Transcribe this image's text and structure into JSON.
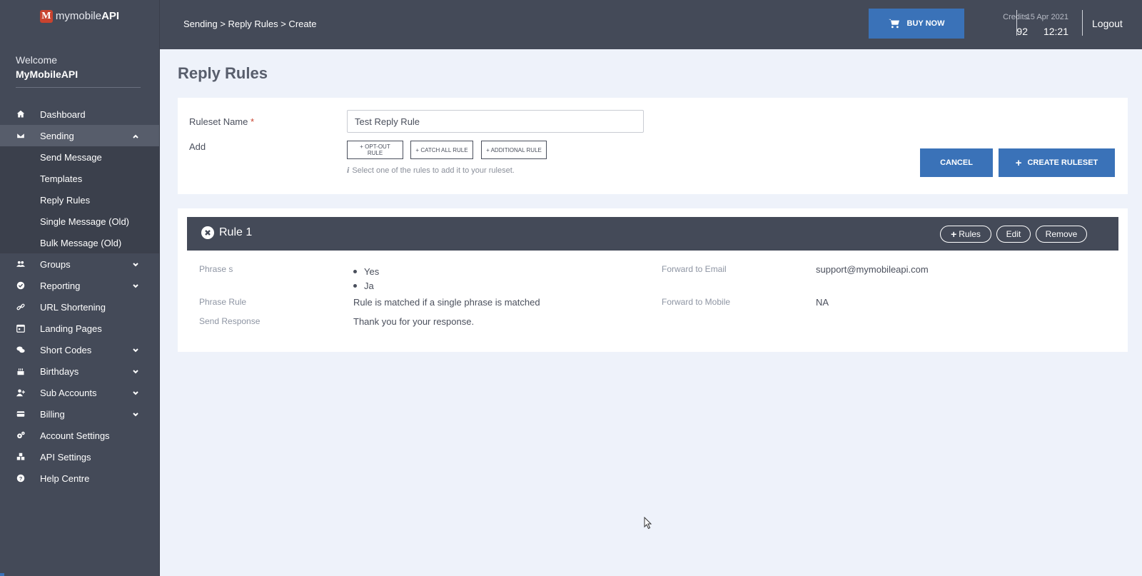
{
  "sidebar": {
    "logo_prefix": "mymobile",
    "logo_suffix": "API",
    "logo_letter": "M",
    "welcome_label": "Welcome",
    "username": "MyMobileAPI",
    "items": [
      {
        "label": "Dashboard",
        "icon": "home-icon"
      },
      {
        "label": "Sending",
        "icon": "envelope-icon",
        "expanded": true
      },
      {
        "label": "Groups",
        "icon": "users-icon"
      },
      {
        "label": "Reporting",
        "icon": "check-circle-icon"
      },
      {
        "label": "URL Shortening",
        "icon": "link-icon"
      },
      {
        "label": "Landing Pages",
        "icon": "calendar-icon"
      },
      {
        "label": "Short Codes",
        "icon": "comments-icon"
      },
      {
        "label": "Birthdays",
        "icon": "cake-icon"
      },
      {
        "label": "Sub Accounts",
        "icon": "user-plus-icon"
      },
      {
        "label": "Billing",
        "icon": "credit-card-icon"
      },
      {
        "label": "Account Settings",
        "icon": "cogs-icon"
      },
      {
        "label": "API Settings",
        "icon": "cubes-icon"
      },
      {
        "label": "Help Centre",
        "icon": "question-circle-icon"
      }
    ],
    "sending_subitems": [
      "Send Message",
      "Templates",
      "Reply Rules",
      "Single Message (Old)",
      "Bulk Message (Old)"
    ]
  },
  "topbar": {
    "breadcrumb": "Sending > Reply Rules > Create",
    "buy_now": "BUY NOW",
    "credits_label": "Credits",
    "credits_value": "92",
    "date": "15 Apr 2021",
    "time": "12:21",
    "logout": "Logout"
  },
  "page": {
    "title": "Reply Rules"
  },
  "form": {
    "ruleset_name_label": "Ruleset Name",
    "required_mark": "*",
    "ruleset_name_value": "Test Reply Rule",
    "add_label": "Add",
    "opt_out_rule": "+ OPT-OUT RULE",
    "catch_all_rule": "+ CATCH ALL RULE",
    "additional_rule": "+ ADDITIONAL RULE",
    "hint": "Select one of the rules to add it to your ruleset.",
    "cancel": "CANCEL",
    "create_ruleset": "CREATE RULESET"
  },
  "rule": {
    "title": "Rule 1",
    "rules_button": "Rules",
    "edit_button": "Edit",
    "remove_button": "Remove",
    "phrases_label": "Phrase s",
    "phrases": [
      "Yes",
      "Ja"
    ],
    "phrase_rule_label": "Phrase Rule",
    "phrase_rule_value": "Rule is matched if a single phrase is matched",
    "send_response_label": "Send Response",
    "send_response_value": "Thank you for your response.",
    "forward_email_label": "Forward to Email",
    "forward_email_value": "support@mymobileapi.com",
    "forward_mobile_label": "Forward to Mobile",
    "forward_mobile_value": "NA"
  },
  "colors": {
    "sidebar_bg": "#444a58",
    "accent": "#3a72b8",
    "page_bg": "#eef2fa",
    "logo_red": "#c9432f"
  }
}
